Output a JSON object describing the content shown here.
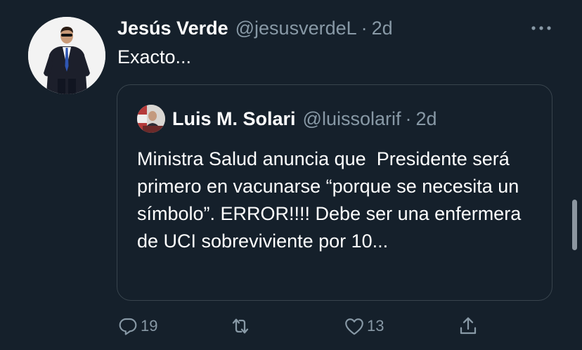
{
  "tweet": {
    "author_name": "Jesús Verde",
    "handle": "@jesusverdeL",
    "separator": "·",
    "time": "2d",
    "text": "Exacto...",
    "avatar_icon": "profile-photo",
    "more_icon": "more-icon"
  },
  "quote": {
    "author_name": "Luis M. Solari",
    "handle": "@luissolarif",
    "separator": "·",
    "time": "2d",
    "text": "Ministra Salud anuncia que  Presidente será primero en vacunarse “porque se necesita un símbolo”. ERROR!!!! Debe ser una enfermera de UCI sobreviviente por 10..."
  },
  "actions": {
    "reply_count": "19",
    "retweet_count": "",
    "like_count": "13",
    "icons": [
      "reply-icon",
      "retweet-icon",
      "like-icon",
      "share-icon"
    ]
  },
  "colors": {
    "background": "#15202b",
    "secondary_text": "#8899a6",
    "border": "#38444d"
  }
}
